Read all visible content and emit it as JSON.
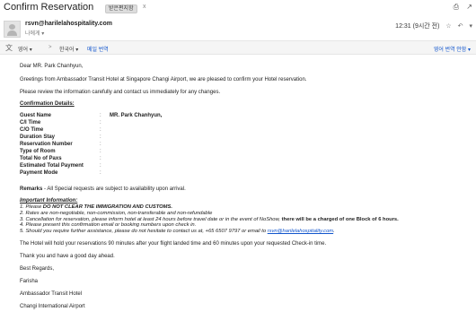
{
  "header": {
    "subject": "Confirm Reservation",
    "tag": "받은편지함",
    "tag_close": "x",
    "print_icon": "print-icon",
    "newwin_icon": "new-window-icon"
  },
  "message": {
    "sender": "rsvn@harilelahospitality.com",
    "to_label": "나에게",
    "time": "12:31 (9시간 전)",
    "star_icon": "star-icon",
    "reply_icon": "reply-icon",
    "more_icon": "more-icon"
  },
  "translate": {
    "from_lang": "영어",
    "arrow": ">",
    "to_lang": "한국어",
    "translate_link": "메일 번역",
    "settings_link": "영어 번역 안함"
  },
  "body": {
    "greeting": "Dear MR. Park Chanhyun,",
    "intro": "Greetings from Ambassador Transit Hotel at Singapore Changi Airport, we are pleased to confirm your Hotel reservation.",
    "review": "Please review the information carefully and contact us immediately for any changes.",
    "confirm_title": "Confirmation Details:",
    "details": [
      {
        "label": "Guest Name",
        "value": "MR. Park Chanhyun,"
      },
      {
        "label": "C/I Time",
        "value": ""
      },
      {
        "label": "C/O Time",
        "value": ""
      },
      {
        "label": "Duration Stay",
        "value": ""
      },
      {
        "label": "Reservation Number",
        "value": ""
      },
      {
        "label": "Type of Room",
        "value": ""
      },
      {
        "label": "Total No of Paxs",
        "value": ""
      },
      {
        "label": "Estimated Total Payment",
        "value": ""
      },
      {
        "label": "Payment Mode",
        "value": ""
      }
    ],
    "colon": ":",
    "remarks_label": "Remarks",
    "remarks_text": " - All Special requests are subject to availability upon arrival.",
    "info_title": "Important Information:",
    "info": {
      "l1_pre": "1. Please ",
      "l1_bold": "DO NOT CLEAR THE IMMIGRATION AND CUSTOMS.",
      "l2": "2. Rates are non-negotiable, non-commission, non-transferable and non-refundable",
      "l3_pre": "3. Cancellation for reservation, please inform hotel at least 24 hours before travel date or in the event of NoShow, ",
      "l3_bold": "there will be a charged of one Block of 6 hours.",
      "l4": "4. Please present this confirmation email or booking numbers upon check in.",
      "l5_pre": "5. Should you require further assistance, please do not hesitate to contact us at, +65 6507 9797 or email to ",
      "l5_link": "rsvn@harilelahospitality.com",
      "l5_post": "."
    },
    "hold": "The Hotel will hold your reservations 90 minutes after your flight landed time and 60 minutes upon your requested Check-in time.",
    "thanks": "Thank you and have a good day ahead.",
    "regards": "Best Regards,",
    "sig_name": "Farisha",
    "sig_hotel": "Ambassador Transit Hotel",
    "sig_place": "Changi International Airport"
  }
}
